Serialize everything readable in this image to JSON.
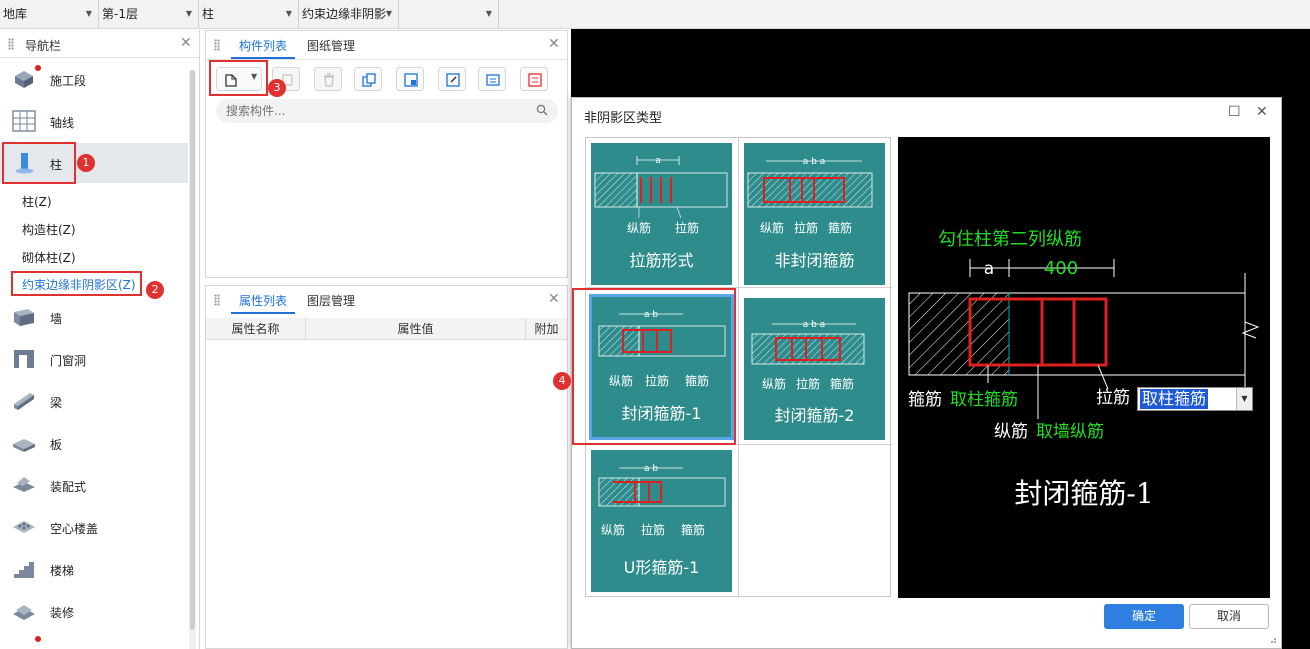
{
  "topbar": {
    "dropdowns": [
      {
        "value": "地库"
      },
      {
        "value": "第-1层"
      },
      {
        "value": "柱"
      },
      {
        "value": "约束边缘非阴影"
      },
      {
        "value": ""
      }
    ]
  },
  "nav": {
    "title": "导航栏",
    "items": [
      {
        "label": "施工段",
        "icon": "construction-segment-icon",
        "badge": true
      },
      {
        "label": "轴线",
        "icon": "grid-axis-icon"
      },
      {
        "label": "柱",
        "icon": "column-icon",
        "active": true
      },
      {
        "label": "墙",
        "icon": "wall-icon"
      },
      {
        "label": "门窗洞",
        "icon": "door-window-icon"
      },
      {
        "label": "梁",
        "icon": "beam-icon"
      },
      {
        "label": "板",
        "icon": "slab-icon"
      },
      {
        "label": "装配式",
        "icon": "prefab-icon"
      },
      {
        "label": "空心楼盖",
        "icon": "hollow-floor-icon"
      },
      {
        "label": "楼梯",
        "icon": "stair-icon"
      },
      {
        "label": "装修",
        "icon": "decoration-icon"
      }
    ],
    "sub_items": [
      "柱(Z)",
      "构造柱(Z)",
      "砌体柱(Z)",
      "约束边缘非阴影区(Z)"
    ]
  },
  "component_panel": {
    "tabs": [
      "构件列表",
      "图纸管理"
    ],
    "search_placeholder": "搜索构件..."
  },
  "property_panel": {
    "tabs": [
      "属性列表",
      "图层管理"
    ],
    "columns": [
      "属性名称",
      "属性值",
      "附加"
    ]
  },
  "dialog": {
    "title": "非阴影区类型",
    "cards": [
      {
        "label": "拉筋形式",
        "dims": "a",
        "labels": [
          "纵筋",
          "拉筋"
        ]
      },
      {
        "label": "非封闭箍筋",
        "dims": "a b a",
        "labels": [
          "纵筋",
          "拉筋",
          "箍筋"
        ]
      },
      {
        "label": "封闭箍筋-1",
        "dims": "a b",
        "labels": [
          "纵筋",
          "拉筋",
          "箍筋"
        ],
        "selected": true
      },
      {
        "label": "封闭箍筋-2",
        "dims": "a b a",
        "labels": [
          "纵筋",
          "拉筋",
          "箍筋"
        ]
      },
      {
        "label": "U形箍筋-1",
        "dims": "a b",
        "labels": [
          "纵筋",
          "拉筋",
          "箍筋"
        ]
      }
    ],
    "preview": {
      "heading": "勾住柱第二列纵筋",
      "dim_a": "a",
      "dim_value": "400",
      "stirrup_label": "箍筋",
      "stirrup_value": "取柱箍筋",
      "tie_label": "拉筋",
      "tie_value": "取柱箍筋",
      "long_label": "纵筋",
      "long_value": "取墙纵筋",
      "caption": "封闭箍筋-1"
    },
    "ok": "确定",
    "cancel": "取消"
  },
  "annotations": [
    "1",
    "2",
    "3",
    "4"
  ],
  "colors": {
    "card_bg": "#2f8c8c",
    "accent_blue": "#1e73d6",
    "annotation_red": "#e03030",
    "preview_green": "#22dd22"
  }
}
